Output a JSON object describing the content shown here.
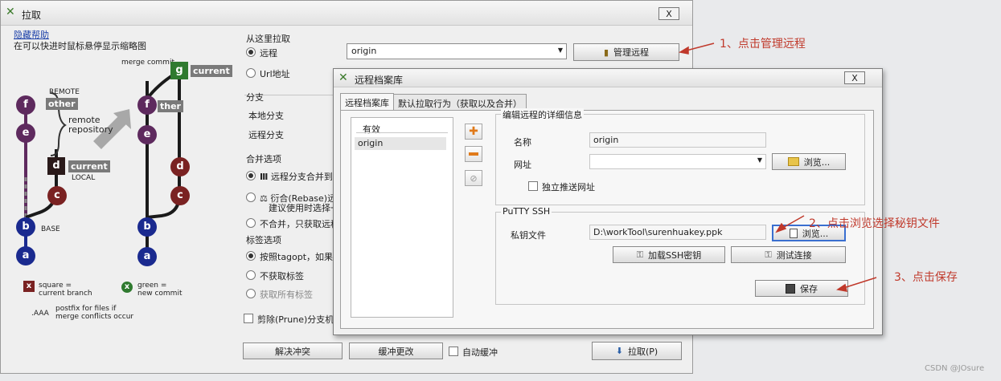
{
  "window": {
    "title": "拉取",
    "close": "X"
  },
  "help": {
    "hide_link": "隐藏帮助",
    "hint": "在可以快进时鼠标悬停显示缩略图"
  },
  "diagram": {
    "merge_commit": "merge commit",
    "remote_label": "REMOTE",
    "local_label": "LOCAL",
    "base_label": "BASE",
    "other": "other",
    "current": "current",
    "other_right": "ther",
    "remote_repository": "remote\nrepository",
    "nodes_left": {
      "f": "f",
      "e": "e",
      "d": "d",
      "c": "c",
      "b": "b",
      "a": "a"
    },
    "nodes_right": {
      "g": "g",
      "f": "f",
      "e": "e",
      "d": "d",
      "c": "c",
      "b": "b",
      "a": "a"
    },
    "legend_x": "x",
    "legend_square": "square =\ncurrent branch",
    "legend_green": "green =\nnew commit",
    "legend_aaa": ".AAA",
    "legend_postfix": "postfix for files if\nmerge conflicts occur"
  },
  "pull_from": {
    "header": "从这里拉取",
    "remote_label": "远程",
    "url_label": "Url地址",
    "remote_value": "origin",
    "manage_button": "管理远程"
  },
  "branch": {
    "header": "分支",
    "local": "本地分支",
    "remote": "远程分支"
  },
  "merge_options": {
    "header": "合并选项",
    "opt1": "远程分支合并到当",
    "opt2a": "衍合(Rebase)远程",
    "opt2b": "建议使用时选择一",
    "opt3": "不合并，只获取远程"
  },
  "tag_options": {
    "header": "标签选项",
    "opt1": "按照tagopt，如果不",
    "opt2": "不获取标签",
    "opt3": "获取所有标签"
  },
  "prune": "剪除(Prune)分支机",
  "bottom": {
    "resolve": "解决冲突",
    "stash": "缓冲更改",
    "auto_stash": "自动缓冲",
    "pull": "拉取(P)"
  },
  "dialog": {
    "title": "远程档案库",
    "tab1": "远程档案库",
    "tab2": "默认拉取行为（获取以及合并）",
    "list_header": "有效",
    "list_item": "origin",
    "detail_header": "编辑远程的详细信息",
    "name_label": "名称",
    "name_value": "origin",
    "url_label": "网址",
    "browse1": "浏览...",
    "push_url": "独立推送网址",
    "putty_header": "PuTTY SSH",
    "key_label": "私钥文件",
    "key_value": "D:\\workTool\\surenhuakey.ppk",
    "browse2": "浏览...",
    "load_key": "加载SSH密钥",
    "test_conn": "测试连接",
    "save": "保存",
    "close": "X"
  },
  "annotations": {
    "a1": "1、点击管理远程",
    "a2": "2、点击浏览选择秘钥文件",
    "a3": "3、点击保存"
  },
  "watermark": "CSDN @JOsure",
  "colors": {
    "annotation": "#c0392b"
  }
}
